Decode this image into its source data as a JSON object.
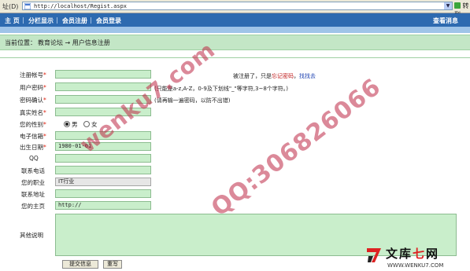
{
  "address_bar": {
    "label": "址(D)",
    "url": "http://localhost/Regist.aspx",
    "go_label": "转到"
  },
  "nav": {
    "items": [
      "主 页",
      "分栏显示",
      "会员注册",
      "会员登录"
    ],
    "right": "查看消息"
  },
  "location": {
    "label": "当前位置：",
    "path": "教育论坛 → 用户信息注册"
  },
  "form": {
    "fields": [
      {
        "label": "注册帐号",
        "required": true,
        "value": ""
      },
      {
        "label": "用户密码",
        "required": true,
        "value": ""
      },
      {
        "label": "密码确认",
        "required": true,
        "value": ""
      },
      {
        "label": "真实姓名",
        "required": true,
        "value": ""
      },
      {
        "label": "您的性别",
        "required": true,
        "value": ""
      },
      {
        "label": "电子信箱",
        "required": true,
        "value": ""
      },
      {
        "label": "出生日期",
        "required": true,
        "value": "1980-01-01"
      },
      {
        "label": "QQ",
        "required": false,
        "value": ""
      },
      {
        "label": "联系电话",
        "required": false,
        "value": ""
      },
      {
        "label": "您的职业",
        "required": false,
        "value": "IT行业"
      },
      {
        "label": "联系地址",
        "required": false,
        "value": ""
      },
      {
        "label": "您的主页",
        "required": false,
        "value": "http://"
      },
      {
        "label": "其他说明",
        "required": false,
        "value": ""
      }
    ],
    "gender_male": "男",
    "gender_female": "女",
    "hint1_a": "被注册了，只是",
    "hint1_link1": "忘记密码",
    "hint1_sep": "，",
    "hint1_link2": "找找去",
    "hint2": "(只能是a-z,A-Z，0-9及下划线\"_\"等字符,3~8个字符。)",
    "hint3": "(请再输一遍密码，以防不出错)",
    "submit": "提交信息",
    "reset": "重写"
  },
  "watermark": {
    "text1": "wenku7.com",
    "text2": "QQ:306826066"
  },
  "brand": {
    "logo_text_a": "文库",
    "logo_text_b": "七",
    "logo_text_c": "网",
    "url": "WWW.WENKU7.COM"
  },
  "colors": {
    "nav_bg": "#2d6ab0",
    "location_bg": "#c3e6c6",
    "input_bg": "#c9eecb",
    "required": "#d21111"
  }
}
